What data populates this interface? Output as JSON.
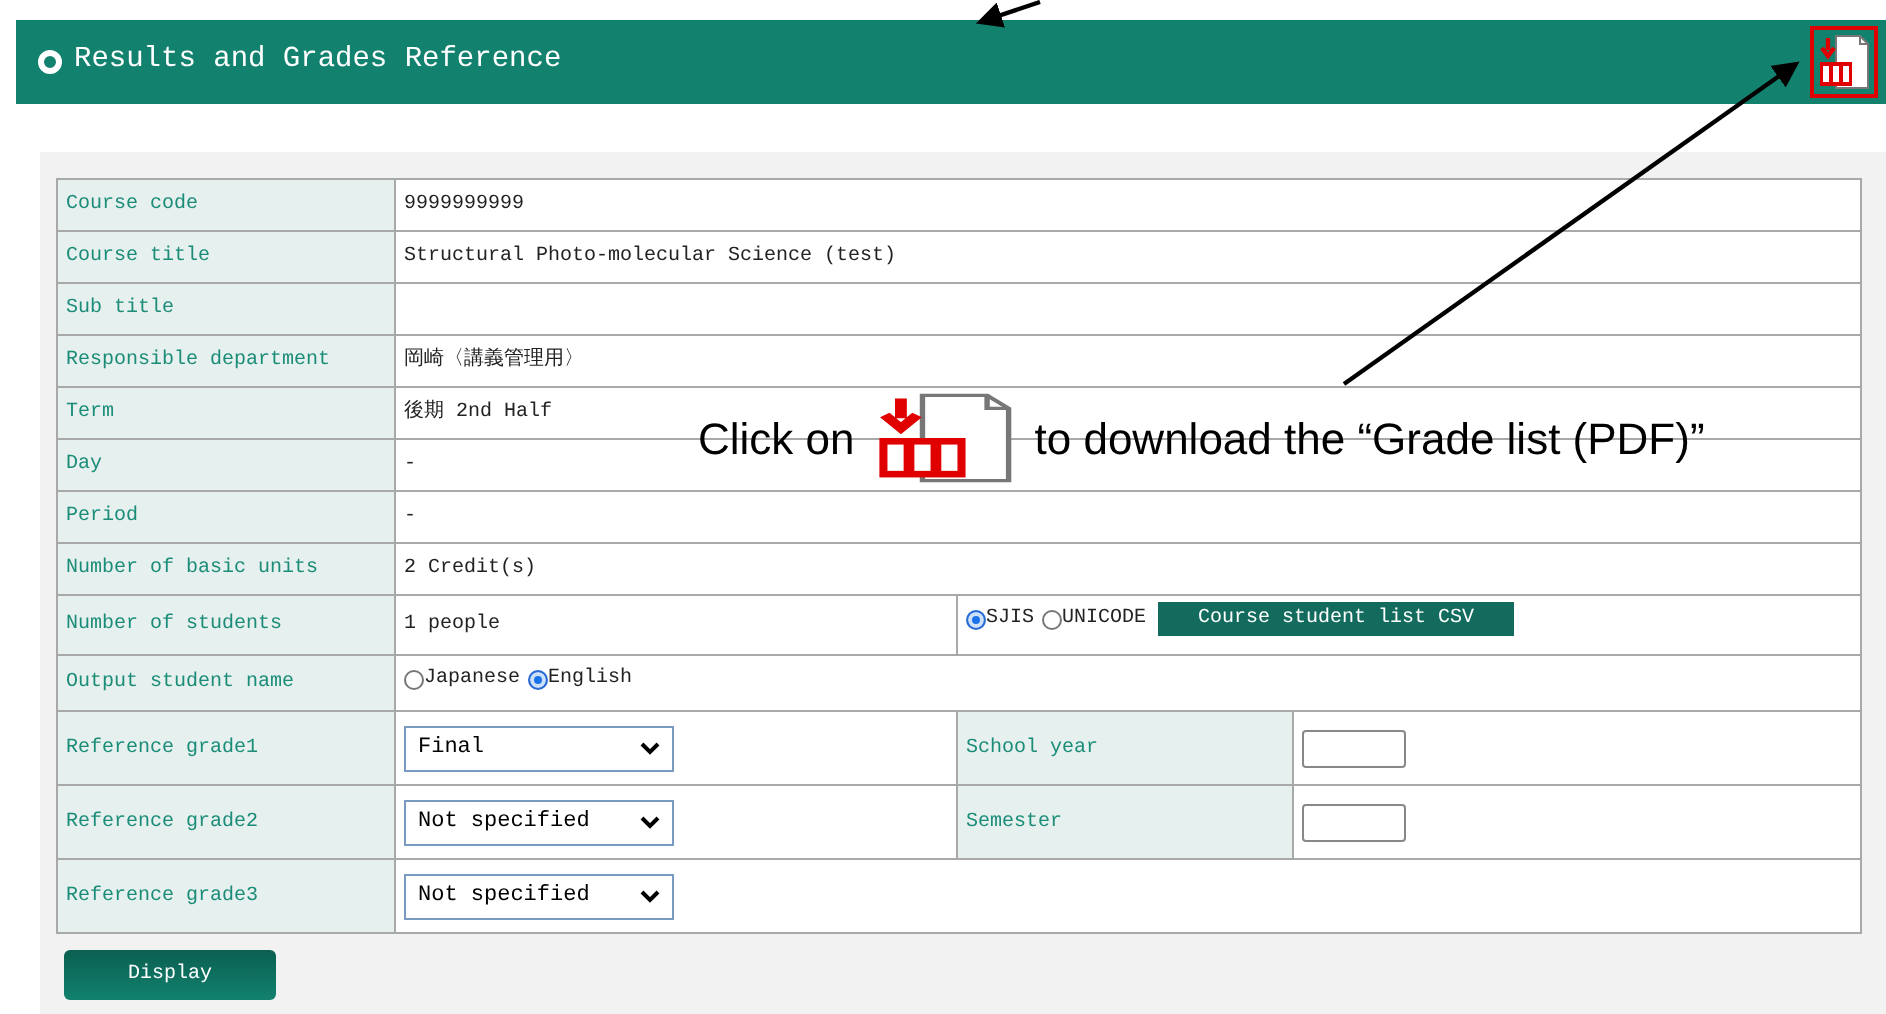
{
  "header": {
    "title": "Results and Grades Reference"
  },
  "rows": [
    {
      "kind": "text",
      "label": "Course code",
      "value": "9999999999"
    },
    {
      "kind": "text",
      "label": "Course title",
      "value": "Structural Photo-molecular Science (test)"
    },
    {
      "kind": "text",
      "label": "Sub title"
    },
    {
      "kind": "text",
      "label": "Responsible department",
      "value": "岡崎〈講義管理用〉"
    },
    {
      "kind": "text",
      "label": "Term",
      "value": "後期 2nd Half"
    },
    {
      "kind": "text",
      "label": "Day",
      "value": "-"
    },
    {
      "kind": "text",
      "label": "Period",
      "value": "-"
    },
    {
      "kind": "text",
      "label": "Number of basic units",
      "value": "2 Credit(s)"
    },
    {
      "kind": "count",
      "label": "Number of students",
      "value": "1 people",
      "encodings": [
        {
          "label": "SJIS",
          "selected": true
        },
        {
          "label": "UNICODE",
          "selected": false
        }
      ],
      "button": "Course student list CSV"
    },
    {
      "kind": "options",
      "label": "Output student name",
      "options": [
        {
          "label": "Japanese",
          "selected": false
        },
        {
          "label": "English",
          "selected": true
        }
      ]
    },
    {
      "kind": "select",
      "label": "Reference grade1",
      "value": "Final",
      "side_label": "School year"
    },
    {
      "kind": "select",
      "label": "Reference grade2",
      "value": "Not specified",
      "side_label": "Semester"
    },
    {
      "kind": "select",
      "label": "Reference grade3",
      "value": "Not specified"
    }
  ],
  "display_button": "Display",
  "callout": {
    "before": "Click on",
    "after": "to download the “Grade list (PDF)”"
  }
}
